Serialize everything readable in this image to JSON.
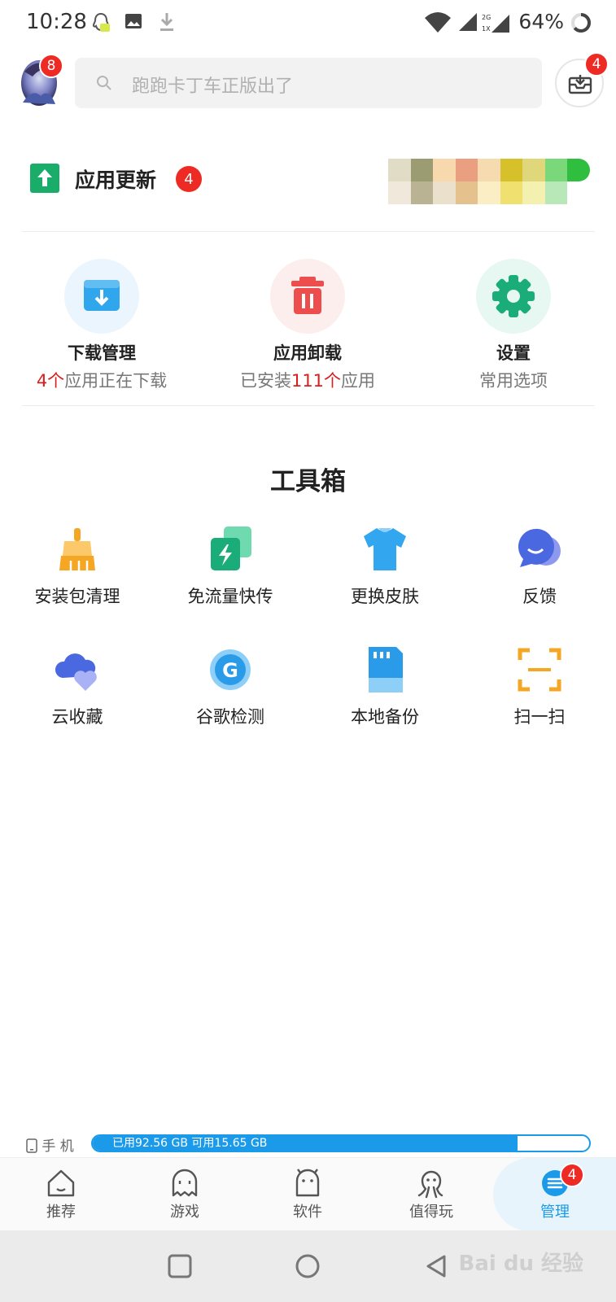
{
  "status_bar": {
    "time": "10:28",
    "battery": "64%",
    "network_labels": [
      "2G",
      "1X"
    ]
  },
  "header": {
    "avatar_badge": "8",
    "search_placeholder": "跑跑卡丁车正版出了",
    "download_badge": "4"
  },
  "update": {
    "label": "应用更新",
    "badge": "4"
  },
  "quick_actions": [
    {
      "title": "下载管理",
      "sub_highlight": "4个",
      "sub_text": "应用正在下载",
      "icon": "download-icon"
    },
    {
      "title": "应用卸载",
      "sub_prefix": "已安装",
      "sub_highlight": "111个",
      "sub_suffix": "应用",
      "icon": "trash-icon"
    },
    {
      "title": "设置",
      "sub_text": "常用选项",
      "icon": "gear-icon"
    }
  ],
  "toolbox": {
    "title": "工具箱",
    "items": [
      {
        "label": "安装包清理",
        "icon": "broom-icon"
      },
      {
        "label": "免流量快传",
        "icon": "flash-transfer-icon"
      },
      {
        "label": "更换皮肤",
        "icon": "shirt-icon"
      },
      {
        "label": "反馈",
        "icon": "chat-icon"
      },
      {
        "label": "云收藏",
        "icon": "cloud-heart-icon"
      },
      {
        "label": "谷歌检测",
        "icon": "google-icon"
      },
      {
        "label": "本地备份",
        "icon": "sd-card-icon"
      },
      {
        "label": "扫一扫",
        "icon": "scan-icon"
      }
    ]
  },
  "storage": {
    "device_label": "手 机",
    "text": "已用92.56 GB 可用15.65 GB",
    "used_fraction": 0.855
  },
  "bottom_nav": {
    "items": [
      {
        "label": "推荐",
        "icon": "house-icon"
      },
      {
        "label": "游戏",
        "icon": "ghost-icon"
      },
      {
        "label": "软件",
        "icon": "android-icon"
      },
      {
        "label": "值得玩",
        "icon": "octopus-icon"
      },
      {
        "label": "管理",
        "icon": "manage-icon",
        "active": true,
        "badge": "4"
      }
    ]
  },
  "colors": {
    "accent_blue": "#1a9ae8",
    "badge_red": "#ee2a24",
    "green": "#1aad69"
  },
  "watermark": "Bai du 经验"
}
